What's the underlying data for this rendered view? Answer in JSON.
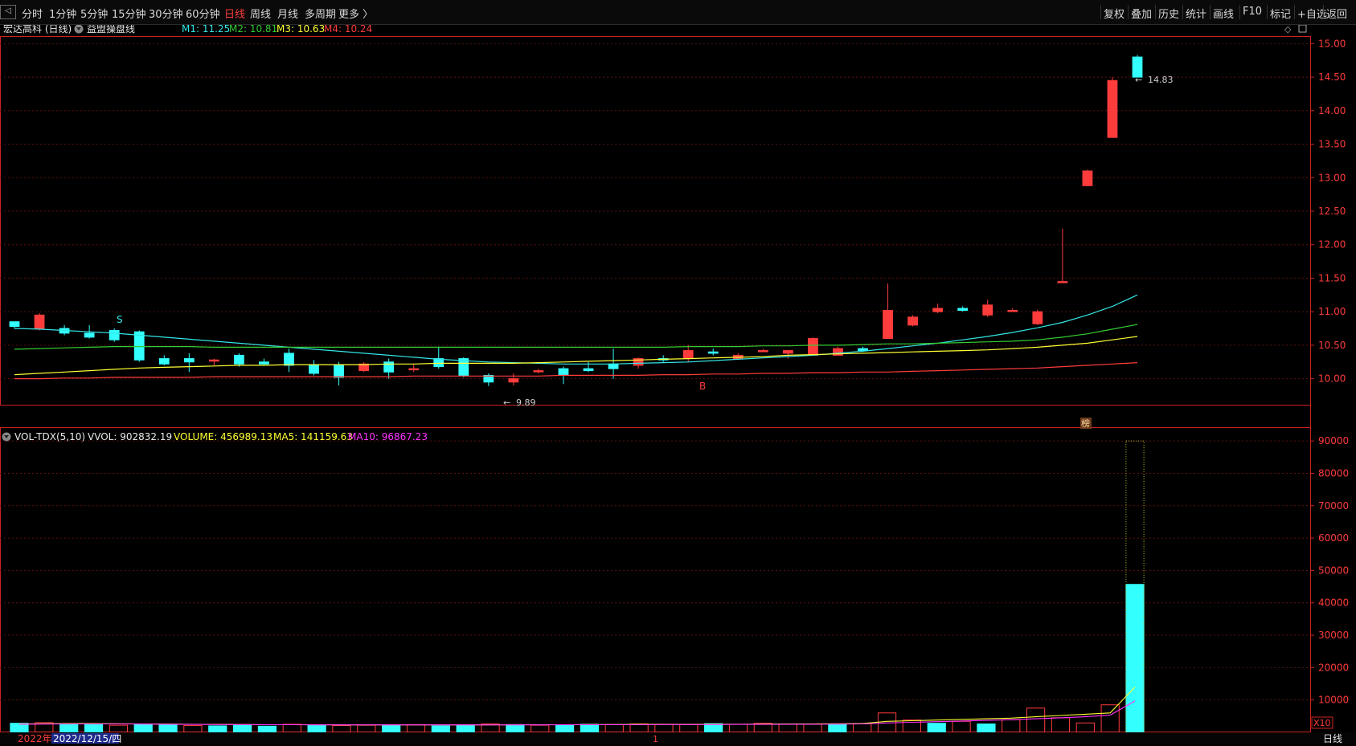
{
  "toolbar": {
    "periods": [
      "分时",
      "1分钟",
      "5分钟",
      "15分钟",
      "30分钟",
      "60分钟",
      "日线",
      "周线",
      "月线",
      "多周期",
      "更多 〉"
    ],
    "active_period": "日线",
    "right_buttons": [
      "复权",
      "叠加",
      "历史",
      "统计",
      "画线",
      "F10",
      "标记",
      "+自选",
      "返回"
    ]
  },
  "main_panel": {
    "stock_name": "宏达高科 (日线)",
    "indicator_name": "益盟操盘线",
    "ma_legend": [
      {
        "label": "M1: 11.25",
        "color": "#33e6e6"
      },
      {
        "label": "M2: 10.81",
        "color": "#33cc33"
      },
      {
        "label": "M3: 10.63",
        "color": "#ffff33"
      },
      {
        "label": "M4: 10.24",
        "color": "#ff3c3c"
      }
    ],
    "y_ticks": [
      "15.00",
      "14.50",
      "14.00",
      "13.50",
      "13.00",
      "12.50",
      "12.00",
      "11.50",
      "11.00",
      "10.50",
      "10.00"
    ],
    "high_label": "14.83",
    "low_label": "9.89",
    "signal_s": "S",
    "signal_b": "B",
    "badge": "榜"
  },
  "volume_panel": {
    "title": "VOL-TDX(5,10)",
    "vvol": "VVOL: 902832.19",
    "volume": "VOLUME: 456989.13",
    "ma5": "MA5: 141159.63",
    "ma10": "MA10: 96867.23",
    "y_ticks": [
      "90000",
      "80000",
      "70000",
      "60000",
      "50000",
      "40000",
      "30000",
      "20000",
      "10000"
    ],
    "unit": "X10"
  },
  "bottom_bar": {
    "year": "2022年",
    "date": "2022/12/15/四",
    "marker": "1",
    "period_label": "日线"
  },
  "colors": {
    "up": "#ff3c3c",
    "down": "#33ffff",
    "grid": "#5a1010",
    "axis": "#cc2222"
  },
  "chart_data": [
    {
      "type": "candlestick",
      "ylim": [
        9.6,
        15.1
      ],
      "candles": [
        {
          "o": 10.85,
          "h": 10.85,
          "l": 10.75,
          "c": 10.78
        },
        {
          "o": 10.75,
          "h": 10.98,
          "l": 10.72,
          "c": 10.95
        },
        {
          "o": 10.75,
          "h": 10.8,
          "l": 10.65,
          "c": 10.68
        },
        {
          "o": 10.68,
          "h": 10.8,
          "l": 10.6,
          "c": 10.62
        },
        {
          "o": 10.72,
          "h": 10.75,
          "l": 10.55,
          "c": 10.58
        },
        {
          "o": 10.7,
          "h": 10.72,
          "l": 10.25,
          "c": 10.28
        },
        {
          "o": 10.3,
          "h": 10.35,
          "l": 10.2,
          "c": 10.22
        },
        {
          "o": 10.3,
          "h": 10.38,
          "l": 10.1,
          "c": 10.25
        },
        {
          "o": 10.28,
          "h": 10.3,
          "l": 10.2,
          "c": 10.28
        },
        {
          "o": 10.35,
          "h": 10.38,
          "l": 10.18,
          "c": 10.22
        },
        {
          "o": 10.25,
          "h": 10.3,
          "l": 10.2,
          "c": 10.22
        },
        {
          "o": 10.38,
          "h": 10.45,
          "l": 10.1,
          "c": 10.2
        },
        {
          "o": 10.2,
          "h": 10.28,
          "l": 10.05,
          "c": 10.08
        },
        {
          "o": 10.2,
          "h": 10.25,
          "l": 9.9,
          "c": 10.02
        },
        {
          "o": 10.12,
          "h": 10.25,
          "l": 10.1,
          "c": 10.22
        },
        {
          "o": 10.25,
          "h": 10.3,
          "l": 10.0,
          "c": 10.1
        },
        {
          "o": 10.15,
          "h": 10.22,
          "l": 10.1,
          "c": 10.15
        },
        {
          "o": 10.3,
          "h": 10.48,
          "l": 10.15,
          "c": 10.18
        },
        {
          "o": 10.3,
          "h": 10.32,
          "l": 10.02,
          "c": 10.05
        },
        {
          "o": 10.05,
          "h": 10.08,
          "l": 9.89,
          "c": 9.95
        },
        {
          "o": 9.95,
          "h": 10.08,
          "l": 9.9,
          "c": 10.0
        },
        {
          "o": 10.12,
          "h": 10.15,
          "l": 10.08,
          "c": 10.12
        },
        {
          "o": 10.15,
          "h": 10.18,
          "l": 9.92,
          "c": 10.05
        },
        {
          "o": 10.15,
          "h": 10.25,
          "l": 10.1,
          "c": 10.12
        },
        {
          "o": 10.22,
          "h": 10.45,
          "l": 10.0,
          "c": 10.15
        },
        {
          "o": 10.2,
          "h": 10.32,
          "l": 10.15,
          "c": 10.3
        },
        {
          "o": 10.3,
          "h": 10.35,
          "l": 10.25,
          "c": 10.28
        },
        {
          "o": 10.3,
          "h": 10.5,
          "l": 10.25,
          "c": 10.42
        },
        {
          "o": 10.4,
          "h": 10.45,
          "l": 10.35,
          "c": 10.38
        },
        {
          "o": 10.3,
          "h": 10.38,
          "l": 10.28,
          "c": 10.35
        },
        {
          "o": 10.42,
          "h": 10.45,
          "l": 10.4,
          "c": 10.42
        },
        {
          "o": 10.38,
          "h": 10.42,
          "l": 10.3,
          "c": 10.42
        },
        {
          "o": 10.35,
          "h": 10.62,
          "l": 10.35,
          "c": 10.6
        },
        {
          "o": 10.35,
          "h": 10.48,
          "l": 10.35,
          "c": 10.45
        },
        {
          "o": 10.45,
          "h": 10.48,
          "l": 10.4,
          "c": 10.42
        },
        {
          "o": 10.6,
          "h": 11.42,
          "l": 10.6,
          "c": 11.02
        },
        {
          "o": 10.8,
          "h": 10.95,
          "l": 10.78,
          "c": 10.92
        },
        {
          "o": 11.0,
          "h": 11.12,
          "l": 10.98,
          "c": 11.05
        },
        {
          "o": 11.05,
          "h": 11.08,
          "l": 11.0,
          "c": 11.02
        },
        {
          "o": 10.95,
          "h": 11.18,
          "l": 10.92,
          "c": 11.1
        },
        {
          "o": 11.02,
          "h": 11.05,
          "l": 11.0,
          "c": 11.02
        },
        {
          "o": 10.82,
          "h": 11.03,
          "l": 10.8,
          "c": 11.0
        },
        {
          "o": 11.44,
          "h": 12.24,
          "l": 11.44,
          "c": 11.45
        },
        {
          "o": 12.88,
          "h": 13.12,
          "l": 12.88,
          "c": 13.1
        },
        {
          "o": 13.6,
          "h": 14.5,
          "l": 13.6,
          "c": 14.45
        },
        {
          "o": 14.8,
          "h": 14.83,
          "l": 14.5,
          "c": 14.5
        }
      ],
      "lines": [
        {
          "name": "M1",
          "color": "#33e6e6",
          "values": [
            10.75,
            10.74,
            10.72,
            10.7,
            10.68,
            10.65,
            10.62,
            10.59,
            10.56,
            10.53,
            10.5,
            10.47,
            10.44,
            10.41,
            10.38,
            10.35,
            10.32,
            10.29,
            10.27,
            10.25,
            10.24,
            10.23,
            10.22,
            10.22,
            10.22,
            10.23,
            10.24,
            10.25,
            10.27,
            10.29,
            10.31,
            10.33,
            10.35,
            10.38,
            10.41,
            10.45,
            10.49,
            10.53,
            10.58,
            10.63,
            10.69,
            10.76,
            10.84,
            10.95,
            11.08,
            11.25
          ]
        },
        {
          "name": "M2",
          "color": "#33cc33",
          "values": [
            10.44,
            10.45,
            10.46,
            10.47,
            10.48,
            10.48,
            10.48,
            10.48,
            10.47,
            10.47,
            10.47,
            10.47,
            10.47,
            10.47,
            10.47,
            10.47,
            10.47,
            10.47,
            10.47,
            10.47,
            10.47,
            10.47,
            10.47,
            10.47,
            10.47,
            10.47,
            10.47,
            10.48,
            10.48,
            10.48,
            10.49,
            10.49,
            10.5,
            10.5,
            10.51,
            10.52,
            10.52,
            10.53,
            10.54,
            10.55,
            10.56,
            10.58,
            10.62,
            10.67,
            10.74,
            10.81
          ]
        },
        {
          "name": "M3",
          "color": "#ffff33",
          "values": [
            10.06,
            10.08,
            10.1,
            10.12,
            10.14,
            10.16,
            10.17,
            10.18,
            10.19,
            10.2,
            10.2,
            10.21,
            10.21,
            10.21,
            10.21,
            10.22,
            10.22,
            10.23,
            10.23,
            10.23,
            10.23,
            10.24,
            10.25,
            10.26,
            10.27,
            10.28,
            10.29,
            10.3,
            10.31,
            10.32,
            10.33,
            10.35,
            10.36,
            10.37,
            10.38,
            10.39,
            10.4,
            10.41,
            10.42,
            10.43,
            10.45,
            10.47,
            10.5,
            10.53,
            10.58,
            10.63
          ]
        },
        {
          "name": "M4",
          "color": "#ff3c3c",
          "values": [
            10.0,
            10.0,
            10.01,
            10.01,
            10.02,
            10.02,
            10.02,
            10.02,
            10.03,
            10.03,
            10.03,
            10.03,
            10.03,
            10.03,
            10.03,
            10.03,
            10.04,
            10.04,
            10.04,
            10.04,
            10.04,
            10.04,
            10.05,
            10.05,
            10.05,
            10.05,
            10.06,
            10.06,
            10.07,
            10.07,
            10.08,
            10.08,
            10.09,
            10.09,
            10.1,
            10.1,
            10.11,
            10.12,
            10.13,
            10.14,
            10.15,
            10.16,
            10.18,
            10.2,
            10.22,
            10.24
          ]
        }
      ]
    },
    {
      "type": "bar",
      "ylim": [
        0,
        94000
      ],
      "values": [
        2800,
        3000,
        2600,
        2500,
        2200,
        2400,
        2300,
        2100,
        2000,
        2400,
        1900,
        2500,
        2300,
        2100,
        2200,
        2300,
        2400,
        2000,
        2300,
        2600,
        2400,
        2200,
        2300,
        2500,
        2400,
        2600,
        2500,
        2400,
        2700,
        2500,
        2800,
        2600,
        2500,
        2400,
        2700,
        6000,
        3800,
        2800,
        3400,
        2600,
        3900,
        7500,
        4500,
        2900,
        8500,
        45700
      ],
      "up": [
        false,
        true,
        false,
        false,
        true,
        false,
        false,
        true,
        false,
        false,
        false,
        true,
        false,
        true,
        true,
        false,
        true,
        false,
        false,
        true,
        false,
        true,
        false,
        false,
        true,
        true,
        true,
        true,
        false,
        true,
        true,
        true,
        true,
        false,
        true,
        true,
        true,
        false,
        true,
        false,
        true,
        true,
        true,
        true,
        true,
        false
      ],
      "hollow_outline": [
        {
          "index": 45,
          "value": 90000
        }
      ],
      "lines": [
        {
          "name": "MA5",
          "color": "#ffff33",
          "values": [
            2600,
            2650,
            2700,
            2700,
            2650,
            2600,
            2550,
            2500,
            2450,
            2400,
            2350,
            2350,
            2350,
            2300,
            2300,
            2300,
            2300,
            2300,
            2300,
            2300,
            2350,
            2350,
            2350,
            2400,
            2400,
            2450,
            2450,
            2450,
            2500,
            2500,
            2550,
            2600,
            2600,
            2650,
            2700,
            3400,
            3600,
            3800,
            4000,
            4200,
            4400,
            4800,
            5200,
            5600,
            6000,
            14000
          ]
        },
        {
          "name": "MA10",
          "color": "#ff33ff",
          "values": [
            2500,
            2550,
            2600,
            2600,
            2600,
            2550,
            2500,
            2450,
            2400,
            2400,
            2350,
            2350,
            2300,
            2300,
            2300,
            2300,
            2300,
            2300,
            2300,
            2300,
            2300,
            2300,
            2350,
            2350,
            2350,
            2350,
            2400,
            2400,
            2400,
            2450,
            2450,
            2500,
            2500,
            2550,
            2600,
            2900,
            3100,
            3300,
            3500,
            3700,
            3900,
            4200,
            4500,
            4800,
            5300,
            9700
          ]
        }
      ]
    }
  ]
}
